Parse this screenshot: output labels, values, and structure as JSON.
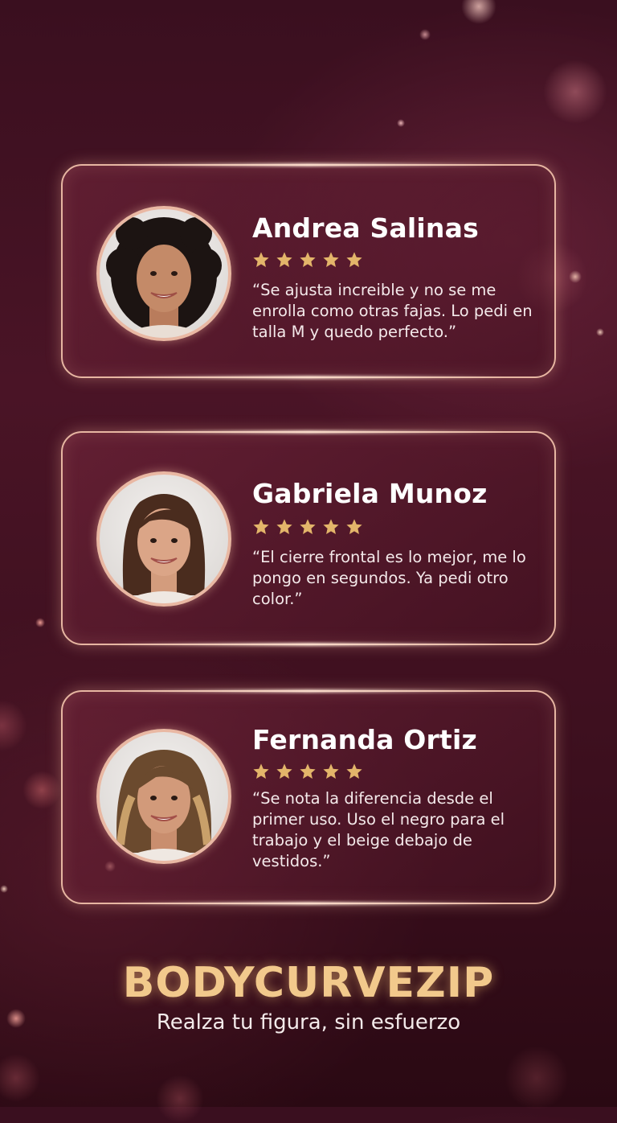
{
  "colors": {
    "background": "#3e1020",
    "card_border": "#e7b6a2",
    "star": "#e3b56a",
    "brand": "#f2c98c"
  },
  "reviews": [
    {
      "name": "Andrea Salinas",
      "rating": 5,
      "quote": "“Se ajusta increible y no se me enrolla como otras fajas. Lo pedi en talla M y quedo perfecto.”"
    },
    {
      "name": "Gabriela Munoz",
      "rating": 5,
      "quote": "“El cierre frontal es lo mejor, me lo pongo en segundos. Ya pedi otro color.”"
    },
    {
      "name": "Fernanda Ortiz",
      "rating": 5,
      "quote": "“Se nota la diferencia desde el primer uso. Uso el negro para el trabajo y el beige debajo de vestidos.”"
    }
  ],
  "brand": {
    "name": "BODYCURVEZIP",
    "tagline": "Realza tu figura, sin esfuerzo"
  }
}
